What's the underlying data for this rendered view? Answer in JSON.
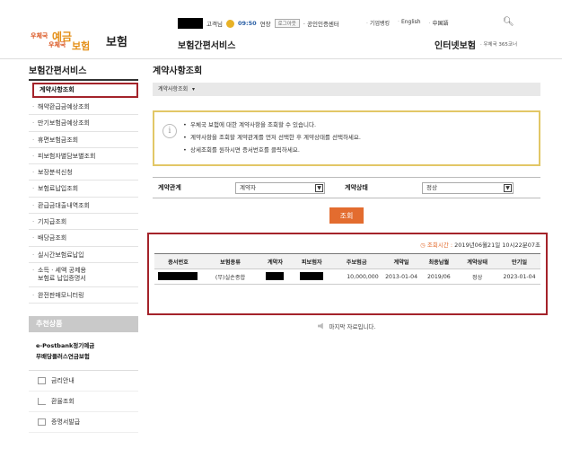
{
  "header": {
    "logo": {
      "word1": "우체국",
      "word2": "예금",
      "word3": "우체국",
      "word4": "보험",
      "brand": "보험"
    },
    "user_suffix": "고객님",
    "time": "09:50",
    "extend": "연장",
    "logout": "로그아웃",
    "cert_center": "· 공인인증센터",
    "utility_links": [
      "기업뱅킹",
      "English",
      "中国語"
    ],
    "page_title": "보험간편서비스",
    "internet_insurance": "인터넷보험",
    "center_link": "· 우체국 365코너"
  },
  "sidebar": {
    "title": "보험간편서비스",
    "items": [
      "계약사항조회",
      "해약환급금예상조회",
      "만기보험금예상조회",
      "휴면보험금조회",
      "피보험자별담보별조회",
      "보장분석신청",
      "보험료납입조회",
      "환급금대출내역조회",
      "기지급조회",
      "배당금조회",
      "실시간보험료납입",
      "소득 · 세액 공제용\n보험료 납입증명서",
      "완전판매모니터링"
    ],
    "promo_head": "추천상품",
    "promo_items": [
      "e-Postbank정기예금",
      "무배당플러스연금보험"
    ],
    "util_items": [
      "금리안내",
      "환율조회",
      "증명서발급"
    ]
  },
  "main": {
    "title": "계약사항조회",
    "breadcrumb": "계약사항조회",
    "notices": [
      "우체국 보험에 대한 계약사항을 조회할 수 있습니다.",
      "계약사항을 조회할 계약관계를 먼저 선택한 후 계약상태를 선택하세요.",
      "상세조회를 원하시면 증서번호를 클릭하세요."
    ],
    "filter": {
      "relation_label": "계약관계",
      "relation_value": "계약자",
      "status_label": "계약상태",
      "status_value": "정상"
    },
    "search_button": "조회",
    "query_time_label": "조회시간 : ",
    "query_time_value": "2019년06월21일 10시22분07초",
    "table": {
      "headers": [
        "증서번호",
        "보험종류",
        "계약자",
        "피보험자",
        "주보험금",
        "계약일",
        "최종납월",
        "계약상태",
        "만기일"
      ],
      "rows": [
        [
          "",
          "(무)실손종합",
          "",
          "",
          "10,000,000",
          "2013-01-04",
          "2019/06",
          "정상",
          "2023-01-04"
        ]
      ]
    },
    "last_data": "마지막 자료입니다."
  }
}
